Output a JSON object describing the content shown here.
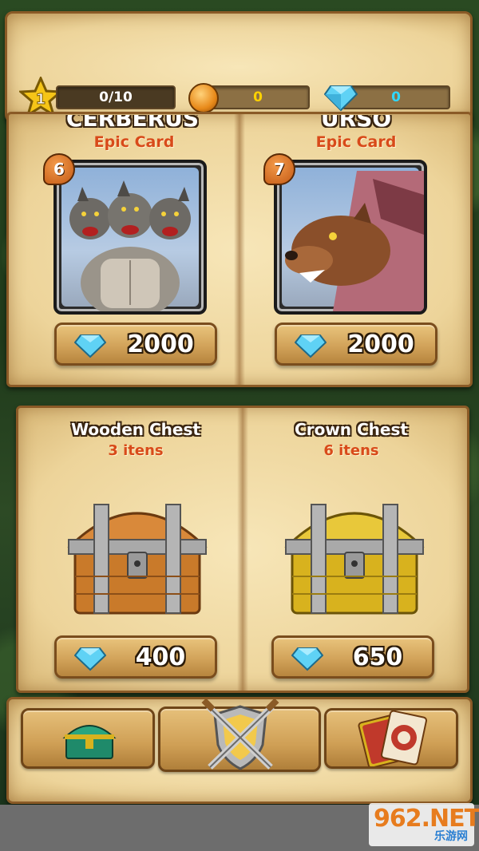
{
  "header": {
    "level": "1",
    "xp_progress": "0/10",
    "gold": "0",
    "gems": "0"
  },
  "cards": [
    {
      "name_cut": "CERBERUS",
      "rarity": "Epic Card",
      "cost": "6",
      "price": "2000"
    },
    {
      "name_cut": "URSO",
      "rarity": "Epic Card",
      "cost": "7",
      "price": "2000"
    }
  ],
  "chests": [
    {
      "title": "Wooden Chest",
      "subtitle": "3 itens",
      "price": "400",
      "color": "#c97a2a"
    },
    {
      "title": "Crown Chest",
      "subtitle": "6 itens",
      "price": "650",
      "color": "#d8b21e"
    }
  ],
  "nav": {
    "tabs": [
      {
        "icon": "treasure-chest-icon"
      },
      {
        "icon": "crossed-swords-shield-icon"
      },
      {
        "icon": "card-deck-icon"
      }
    ]
  },
  "watermark": {
    "brand": "962.NET",
    "sub": "乐游网"
  },
  "colors": {
    "gold_text": "#ffd200",
    "gem_text": "#2fd9ff",
    "epic_text": "#d84a1a"
  }
}
